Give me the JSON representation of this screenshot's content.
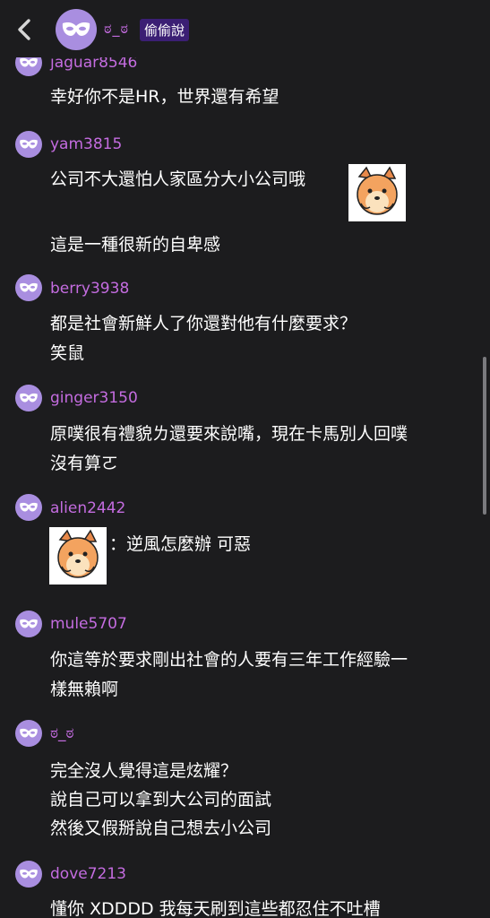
{
  "header": {
    "name": "ಠ_ಠ",
    "badge": "偷偷說"
  },
  "comments": [
    {
      "user": "jaguar8546",
      "lines": [
        "幸好你不是HR，世界還有希望"
      ]
    },
    {
      "user": "yam3815",
      "lines": [
        "公司不大還怕人家區分大小公司哦",
        "這是一種很新的自卑感"
      ]
    },
    {
      "user": "berry3938",
      "lines": [
        "都是社會新鮮人了你還對他有什麼要求？",
        "笑鼠"
      ]
    },
    {
      "user": "ginger3150",
      "lines": [
        "原噗很有禮貌ㄌ還要來說嘴，現在卡馬別人回噗",
        "沒有算ㄛ"
      ]
    },
    {
      "user": "alien2442",
      "lines": [
        "：逆風怎麼辦 可惡"
      ]
    },
    {
      "user": "mule5707",
      "lines": [
        "你這等於要求剛出社會的人要有三年工作經驗一",
        "樣無賴啊"
      ]
    },
    {
      "user": "ಠ_ಠ",
      "lines": [
        "完全沒人覺得這是炫耀？",
        "說自己可以拿到大公司的面試",
        "然後又假掰說自己想去小公司"
      ]
    },
    {
      "user": "dove7213",
      "lines": [
        "懂你 XDDDD 我每天刷到這些都忍住不吐槽"
      ]
    }
  ]
}
